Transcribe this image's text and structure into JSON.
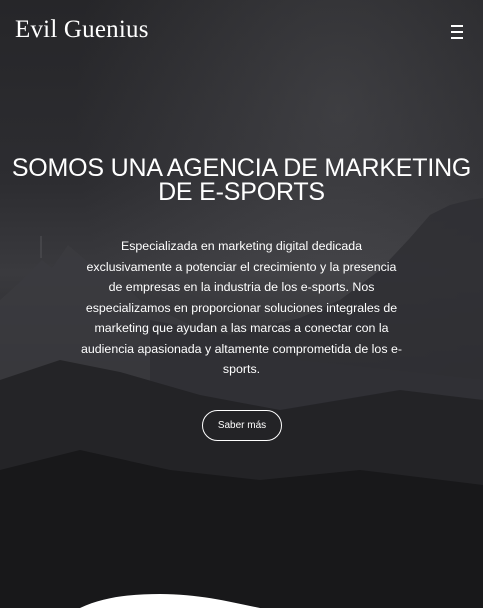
{
  "header": {
    "logo": "Evil Guenius",
    "menu_icon": "hamburger-menu-icon"
  },
  "hero": {
    "title_line1": "SOMOS UNA AGENCIA DE MARKETING",
    "title_line2": "DE E-SPORTS",
    "description": "Especializada en marketing digital dedicada exclusivamente a potenciar el crecimiento y la presencia de empresas en la industria de los e-sports. Nos especializamos en proporcionar soluciones integrales de marketing que ayudan a las marcas a conectar con la audiencia apasionada y altamente comprometida de los e-sports.",
    "cta_label": "Saber más"
  }
}
